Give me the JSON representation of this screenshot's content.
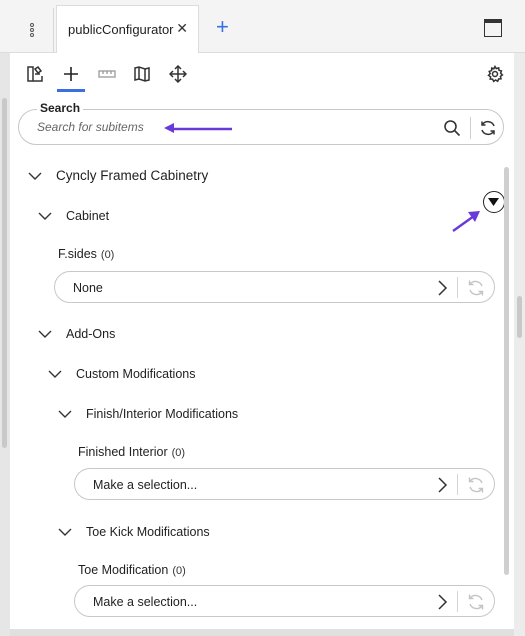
{
  "tabs": {
    "menu_icon": "kebab-vertical-icon",
    "active_tab": "publicConfigurator",
    "close_icon": "close-icon",
    "add_icon": "plus-icon",
    "window_icon": "window-icon"
  },
  "toolbar": {
    "icons": [
      "catalog-icon",
      "add-icon",
      "dimension-icon",
      "map-icon",
      "move-icon",
      "settings-icon"
    ],
    "active_index": 1,
    "accent_color": "#3a6fe0"
  },
  "search": {
    "label": "Search",
    "placeholder": "Search for subitems"
  },
  "tree": {
    "root": "Cyncly Framed Cabinetry",
    "cabinet": "Cabinet",
    "fsides": {
      "label": "F.sides",
      "count": "(0)",
      "value": "None"
    },
    "addons": "Add-Ons",
    "custom_mods": "Custom Modifications",
    "finish_mods": "Finish/Interior Modifications",
    "finished_interior": {
      "label": "Finished Interior",
      "count": "(0)",
      "value": "Make a selection..."
    },
    "toe_kick_mods": "Toe Kick Modifications",
    "toe_modification": {
      "label": "Toe Modification",
      "count": "(0)",
      "value": "Make a selection..."
    }
  },
  "annotation_color": "#6a3ad9"
}
